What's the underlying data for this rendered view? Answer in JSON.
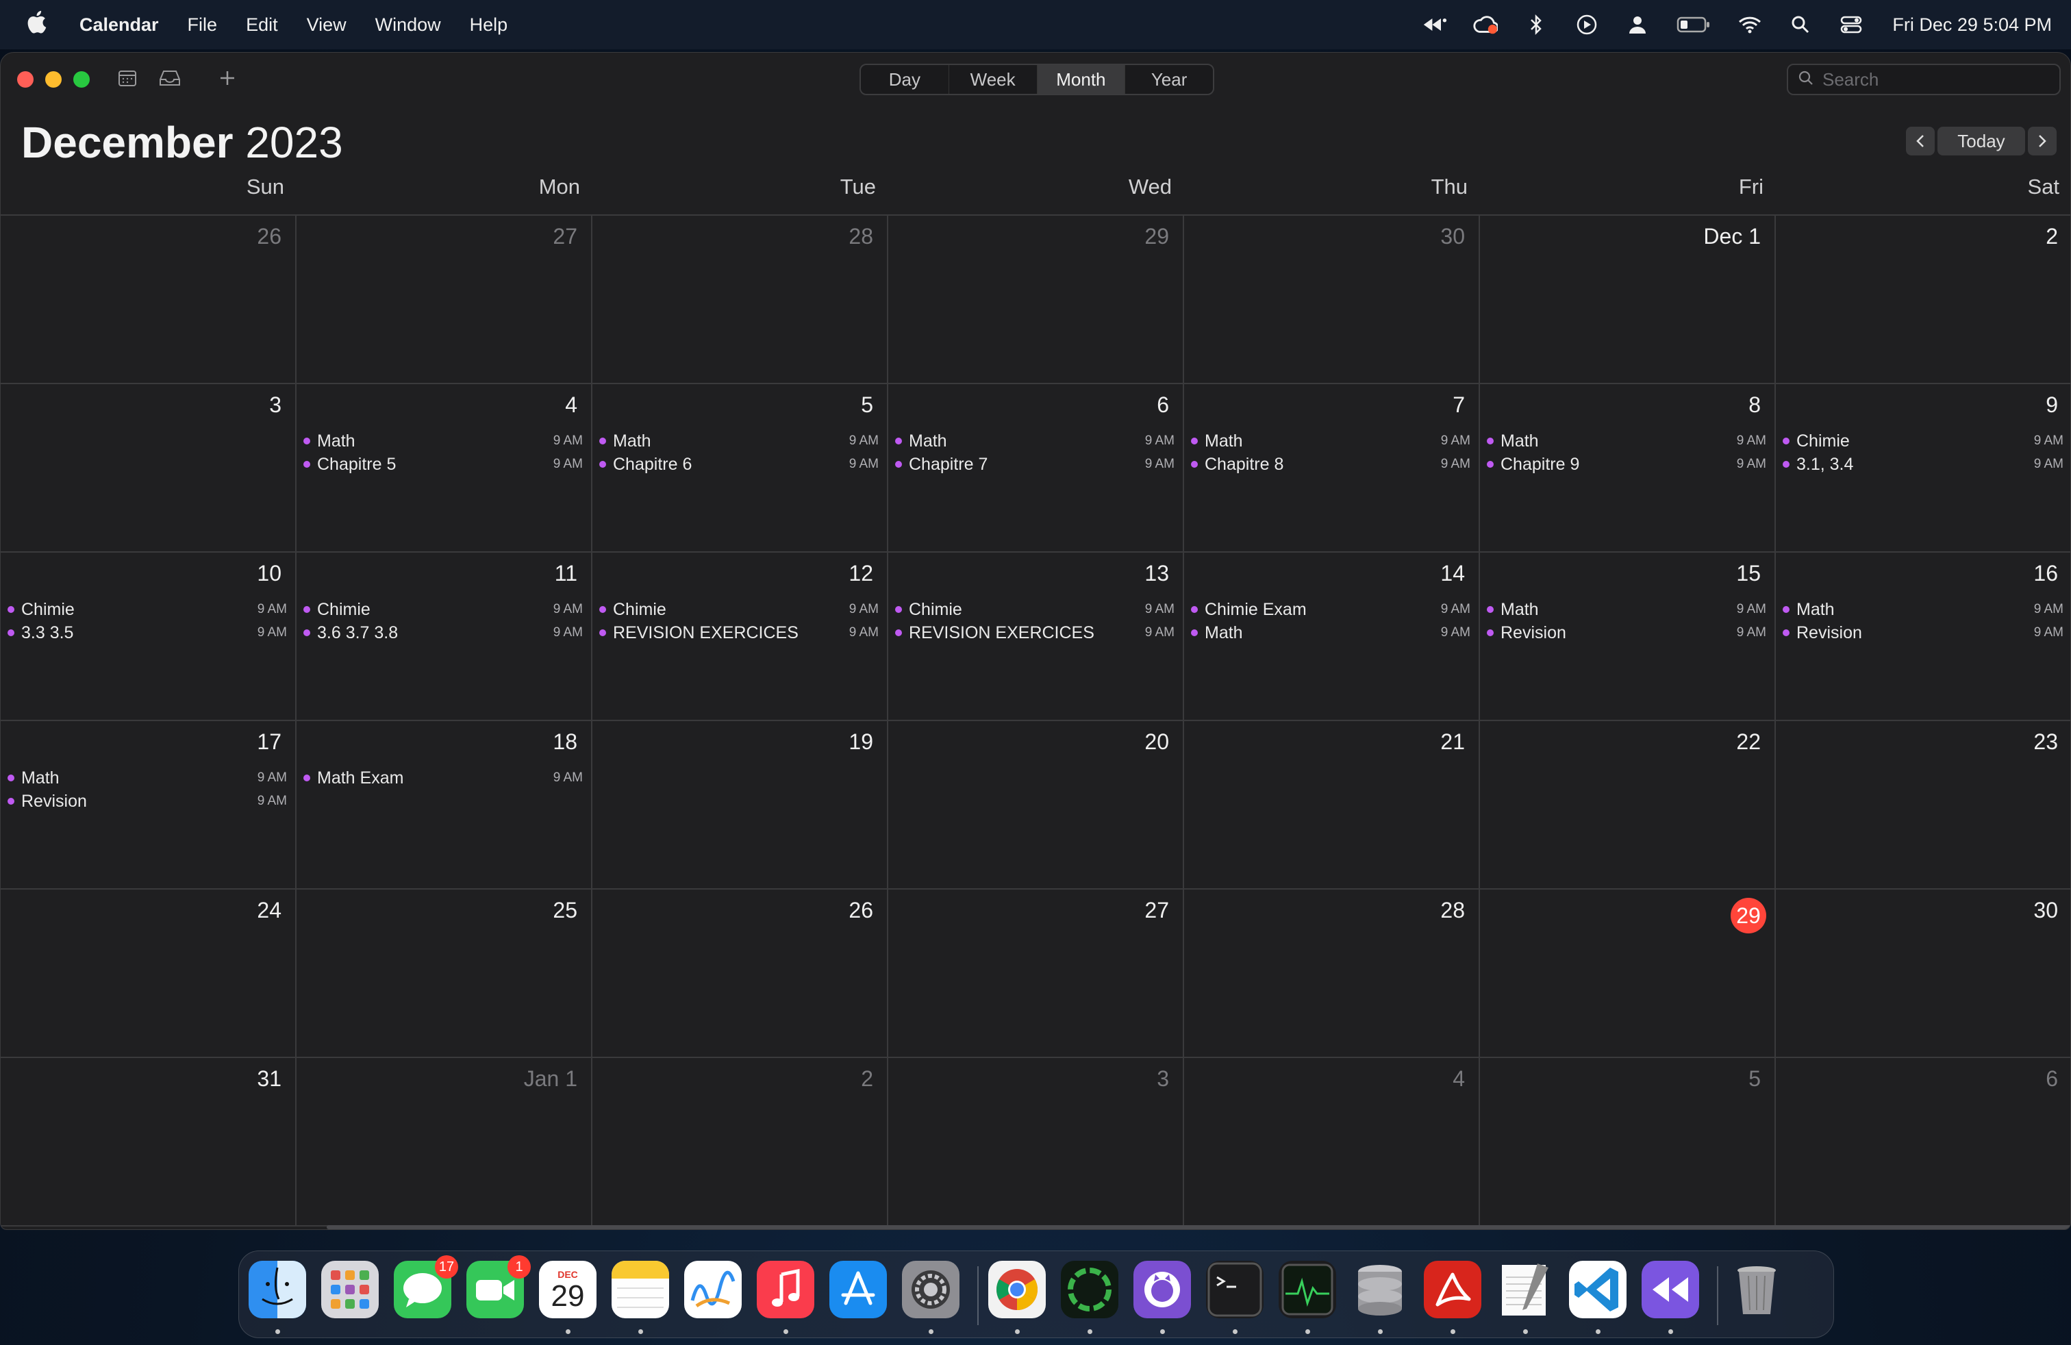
{
  "menubar": {
    "apple": "",
    "app_name": "Calendar",
    "items": [
      "File",
      "Edit",
      "View",
      "Window",
      "Help"
    ],
    "clock": "Fri Dec 29  5:04 PM"
  },
  "toolbar": {
    "views": [
      "Day",
      "Week",
      "Month",
      "Year"
    ],
    "active_view": "Month",
    "search_placeholder": "Search"
  },
  "header": {
    "month": "December",
    "year": "2023",
    "today_label": "Today"
  },
  "weekdays": [
    "Sun",
    "Mon",
    "Tue",
    "Wed",
    "Thu",
    "Fri",
    "Sat"
  ],
  "weeks": [
    [
      {
        "day": "26",
        "other": true,
        "events": []
      },
      {
        "day": "27",
        "other": true,
        "events": []
      },
      {
        "day": "28",
        "other": true,
        "events": []
      },
      {
        "day": "29",
        "other": true,
        "events": []
      },
      {
        "day": "30",
        "other": true,
        "events": []
      },
      {
        "day": "Dec 1",
        "events": []
      },
      {
        "day": "2",
        "events": []
      }
    ],
    [
      {
        "day": "3",
        "events": []
      },
      {
        "day": "4",
        "events": [
          {
            "name": "Math",
            "time": "9 AM"
          },
          {
            "name": "Chapitre 5",
            "time": "9 AM"
          }
        ]
      },
      {
        "day": "5",
        "events": [
          {
            "name": "Math",
            "time": "9 AM"
          },
          {
            "name": "Chapitre 6",
            "time": "9 AM"
          }
        ]
      },
      {
        "day": "6",
        "events": [
          {
            "name": "Math",
            "time": "9 AM"
          },
          {
            "name": "Chapitre 7",
            "time": "9 AM"
          }
        ]
      },
      {
        "day": "7",
        "events": [
          {
            "name": "Math",
            "time": "9 AM"
          },
          {
            "name": "Chapitre 8",
            "time": "9 AM"
          }
        ]
      },
      {
        "day": "8",
        "events": [
          {
            "name": "Math",
            "time": "9 AM"
          },
          {
            "name": "Chapitre 9",
            "time": "9 AM"
          }
        ]
      },
      {
        "day": "9",
        "events": [
          {
            "name": "Chimie",
            "time": "9 AM"
          },
          {
            "name": "3.1, 3.4",
            "time": "9 AM"
          }
        ]
      }
    ],
    [
      {
        "day": "10",
        "events": [
          {
            "name": "Chimie",
            "time": "9 AM"
          },
          {
            "name": "3.3 3.5",
            "time": "9 AM"
          }
        ]
      },
      {
        "day": "11",
        "events": [
          {
            "name": "Chimie",
            "time": "9 AM"
          },
          {
            "name": "3.6 3.7 3.8",
            "time": "9 AM"
          }
        ]
      },
      {
        "day": "12",
        "events": [
          {
            "name": "Chimie",
            "time": "9 AM"
          },
          {
            "name": "REVISION EXERCICES",
            "time": "9 AM"
          }
        ]
      },
      {
        "day": "13",
        "events": [
          {
            "name": "Chimie",
            "time": "9 AM"
          },
          {
            "name": "REVISION EXERCICES",
            "time": "9 AM"
          }
        ]
      },
      {
        "day": "14",
        "events": [
          {
            "name": "Chimie Exam",
            "time": "9 AM"
          },
          {
            "name": "Math",
            "time": "9 AM"
          }
        ]
      },
      {
        "day": "15",
        "events": [
          {
            "name": "Math",
            "time": "9 AM"
          },
          {
            "name": "Revision",
            "time": "9 AM"
          }
        ]
      },
      {
        "day": "16",
        "events": [
          {
            "name": "Math",
            "time": "9 AM"
          },
          {
            "name": "Revision",
            "time": "9 AM"
          }
        ]
      }
    ],
    [
      {
        "day": "17",
        "events": [
          {
            "name": "Math",
            "time": "9 AM"
          },
          {
            "name": "Revision",
            "time": "9 AM"
          }
        ]
      },
      {
        "day": "18",
        "events": [
          {
            "name": "Math Exam",
            "time": "9 AM"
          }
        ]
      },
      {
        "day": "19",
        "events": []
      },
      {
        "day": "20",
        "events": []
      },
      {
        "day": "21",
        "events": []
      },
      {
        "day": "22",
        "events": []
      },
      {
        "day": "23",
        "events": []
      }
    ],
    [
      {
        "day": "24",
        "events": []
      },
      {
        "day": "25",
        "events": []
      },
      {
        "day": "26",
        "events": []
      },
      {
        "day": "27",
        "events": []
      },
      {
        "day": "28",
        "events": []
      },
      {
        "day": "29",
        "today": true,
        "events": []
      },
      {
        "day": "30",
        "events": []
      }
    ],
    [
      {
        "day": "31",
        "events": []
      },
      {
        "day": "Jan 1",
        "other": true,
        "events": []
      },
      {
        "day": "2",
        "other": true,
        "events": []
      },
      {
        "day": "3",
        "other": true,
        "events": []
      },
      {
        "day": "4",
        "other": true,
        "events": []
      },
      {
        "day": "5",
        "other": true,
        "events": []
      },
      {
        "day": "6",
        "other": true,
        "events": []
      }
    ]
  ],
  "colors": {
    "event_dot": "#bf5af2",
    "today": "#ff453a",
    "background": "#1f1f21"
  },
  "dock": {
    "icons": [
      {
        "name": "finder-icon",
        "running": true
      },
      {
        "name": "launchpad-icon",
        "running": false
      },
      {
        "name": "messages-icon",
        "running": false,
        "badge": "17"
      },
      {
        "name": "facetime-icon",
        "running": false,
        "badge": "1"
      },
      {
        "name": "calendar-icon",
        "running": true,
        "month": "DEC",
        "day": "29"
      },
      {
        "name": "notes-icon",
        "running": true
      },
      {
        "name": "freeform-icon",
        "running": false
      },
      {
        "name": "music-icon",
        "running": true
      },
      {
        "name": "app-store-icon",
        "running": false
      },
      {
        "name": "system-settings-icon",
        "running": true
      },
      {
        "name": "chrome-icon",
        "running": true
      },
      {
        "name": "progress-ring-icon",
        "running": true
      },
      {
        "name": "github-icon",
        "running": true
      },
      {
        "name": "terminal-icon",
        "running": true
      },
      {
        "name": "activity-monitor-icon",
        "running": true
      },
      {
        "name": "database-icon",
        "running": true
      },
      {
        "name": "acrobat-icon",
        "running": true
      },
      {
        "name": "textedit-icon",
        "running": true
      },
      {
        "name": "vscode-icon",
        "running": true
      },
      {
        "name": "rewind-icon",
        "running": true
      },
      {
        "name": "trash-icon",
        "running": false
      }
    ]
  }
}
